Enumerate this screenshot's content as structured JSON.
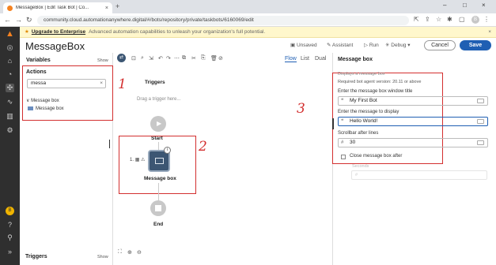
{
  "browser": {
    "tab_title": "MessageBox | Edit Task Bot | Co...",
    "url": "community.cloud.automationanywhere.digital/#/bots/repository/private/taskbots/6160069/edit",
    "profile_initial": "B"
  },
  "banner": {
    "upgrade": "Upgrade to Enterprise",
    "message": "Advanced automation capabilities to unleash your organization's full potential."
  },
  "header": {
    "title": "MessageBox",
    "unsaved": "Unsaved",
    "assistant": "Assistant",
    "run": "Run",
    "debug": "Debug",
    "cancel": "Cancel",
    "save": "Save"
  },
  "left": {
    "variables": "Variables",
    "show": "Show",
    "actions": "Actions",
    "search_value": "messa",
    "group": "Message box",
    "item": "Message box",
    "triggers": "Triggers",
    "triggers_show": "Show"
  },
  "canvas": {
    "views": [
      "Flow",
      "List",
      "Dual"
    ],
    "triggers_title": "Triggers",
    "drag_hint": "Drag a trigger here...",
    "start": "Start",
    "node_number": "1.",
    "node_label": "Message box",
    "end": "End",
    "annotations": [
      "1",
      "2",
      "3"
    ]
  },
  "right": {
    "title": "Message box",
    "desc": "Displays a message box",
    "version": "Required bot agent version: 20.11 or above",
    "title_label": "Enter the message box window title",
    "title_value": "My First Bot",
    "msg_label": "Enter the message to display",
    "msg_value": "Hello World!",
    "scroll_label": "Scrollbar after lines",
    "scroll_value": "30",
    "close_label": "Close message box after",
    "seconds": "Seconds"
  },
  "colors": {
    "accent": "#1f5fb3",
    "annotation": "#d32f2f",
    "sidebar": "#2f2f2f",
    "banner": "#fff7cc"
  }
}
